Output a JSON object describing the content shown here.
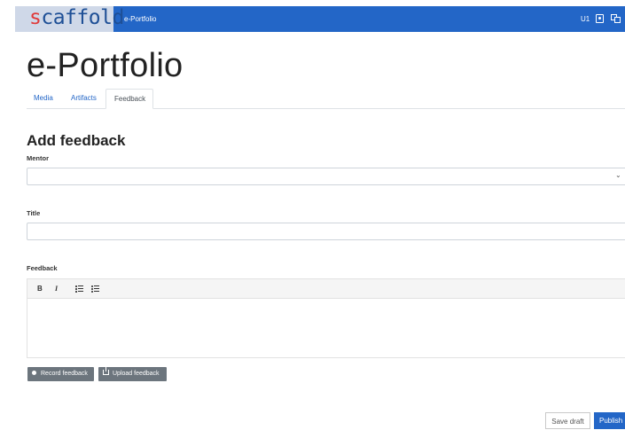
{
  "header": {
    "logo_prefix": "s",
    "logo_rest": "caffold",
    "app_name": "e-Portfolio",
    "user_initials": "U1",
    "user_icon": "user-badge-icon",
    "language_icon": "language-switch-icon",
    "bar_color": "#2366c7"
  },
  "page": {
    "title": "e-Portfolio"
  },
  "tabs": [
    {
      "label": "Media",
      "active": false
    },
    {
      "label": "Artifacts",
      "active": false
    },
    {
      "label": "Feedback",
      "active": true
    }
  ],
  "form": {
    "heading": "Add feedback",
    "mentor_label": "Mentor",
    "mentor_value": "",
    "title_label": "Title",
    "title_value": "",
    "feedback_label": "Feedback",
    "toolbar": {
      "bold": "B",
      "italic": "I"
    },
    "record_label": "Record feedback",
    "upload_label": "Upload feedback"
  },
  "actions": {
    "save_draft": "Save draft",
    "publish": "Publish"
  }
}
